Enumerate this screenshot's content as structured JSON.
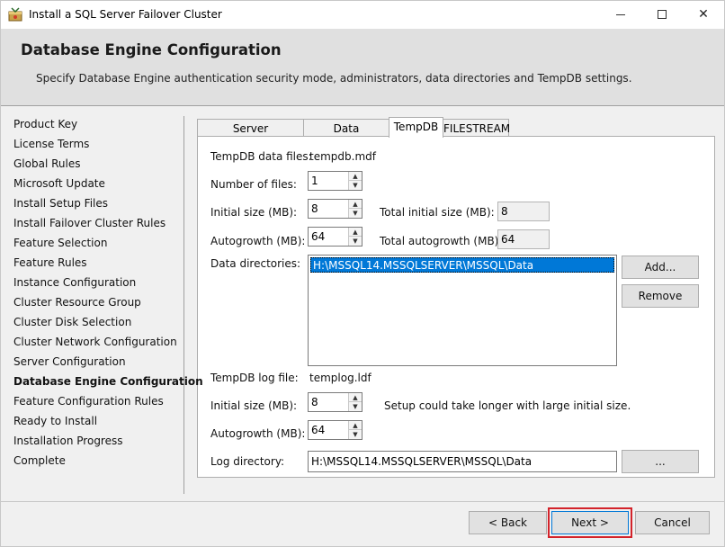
{
  "window": {
    "title": "Install a SQL Server Failover Cluster",
    "minimize_label": "",
    "maximize_label": "",
    "close_label": "✕"
  },
  "header": {
    "title": "Database Engine Configuration",
    "description": "Specify Database Engine authentication security mode, administrators, data directories and TempDB settings."
  },
  "sidebar": {
    "items": [
      {
        "label": "Product Key"
      },
      {
        "label": "License Terms"
      },
      {
        "label": "Global Rules"
      },
      {
        "label": "Microsoft Update"
      },
      {
        "label": "Install Setup Files"
      },
      {
        "label": "Install Failover Cluster Rules"
      },
      {
        "label": "Feature Selection"
      },
      {
        "label": "Feature Rules"
      },
      {
        "label": "Instance Configuration"
      },
      {
        "label": "Cluster Resource Group"
      },
      {
        "label": "Cluster Disk Selection"
      },
      {
        "label": "Cluster Network Configuration"
      },
      {
        "label": "Server Configuration"
      },
      {
        "label": "Database Engine Configuration"
      },
      {
        "label": "Feature Configuration Rules"
      },
      {
        "label": "Ready to Install"
      },
      {
        "label": "Installation Progress"
      },
      {
        "label": "Complete"
      }
    ],
    "active_index": 13
  },
  "tabs": [
    {
      "label": "Server Configuration"
    },
    {
      "label": "Data Directories"
    },
    {
      "label": "TempDB"
    },
    {
      "label": "FILESTREAM"
    }
  ],
  "tempdb": {
    "data_files_label": "TempDB data files:",
    "data_files_value": "tempdb.mdf",
    "num_files_label": "Number of files:",
    "num_files_value": "1",
    "initial_size_label": "Initial size (MB):",
    "initial_size_value": "8",
    "total_initial_label": "Total initial size (MB):",
    "total_initial_value": "8",
    "autogrowth_label": "Autogrowth (MB):",
    "autogrowth_value": "64",
    "total_autogrowth_label": "Total autogrowth (MB):",
    "total_autogrowth_value": "64",
    "data_dirs_label": "Data directories:",
    "data_dirs": [
      "H:\\MSSQL14.MSSQLSERVER\\MSSQL\\Data"
    ],
    "add_label": "Add...",
    "remove_label": "Remove",
    "log_file_label": "TempDB log file:",
    "log_file_value": "templog.ldf",
    "log_initial_label": "Initial size (MB):",
    "log_initial_value": "8",
    "log_warning": "Setup could take longer with large initial size.",
    "log_autogrowth_label": "Autogrowth (MB):",
    "log_autogrowth_value": "64",
    "log_dir_label": "Log directory:",
    "log_dir_value": "H:\\MSSQL14.MSSQLSERVER\\MSSQL\\Data",
    "browse_label": "..."
  },
  "footer": {
    "back_label": "< Back",
    "next_label": "Next >",
    "cancel_label": "Cancel"
  }
}
